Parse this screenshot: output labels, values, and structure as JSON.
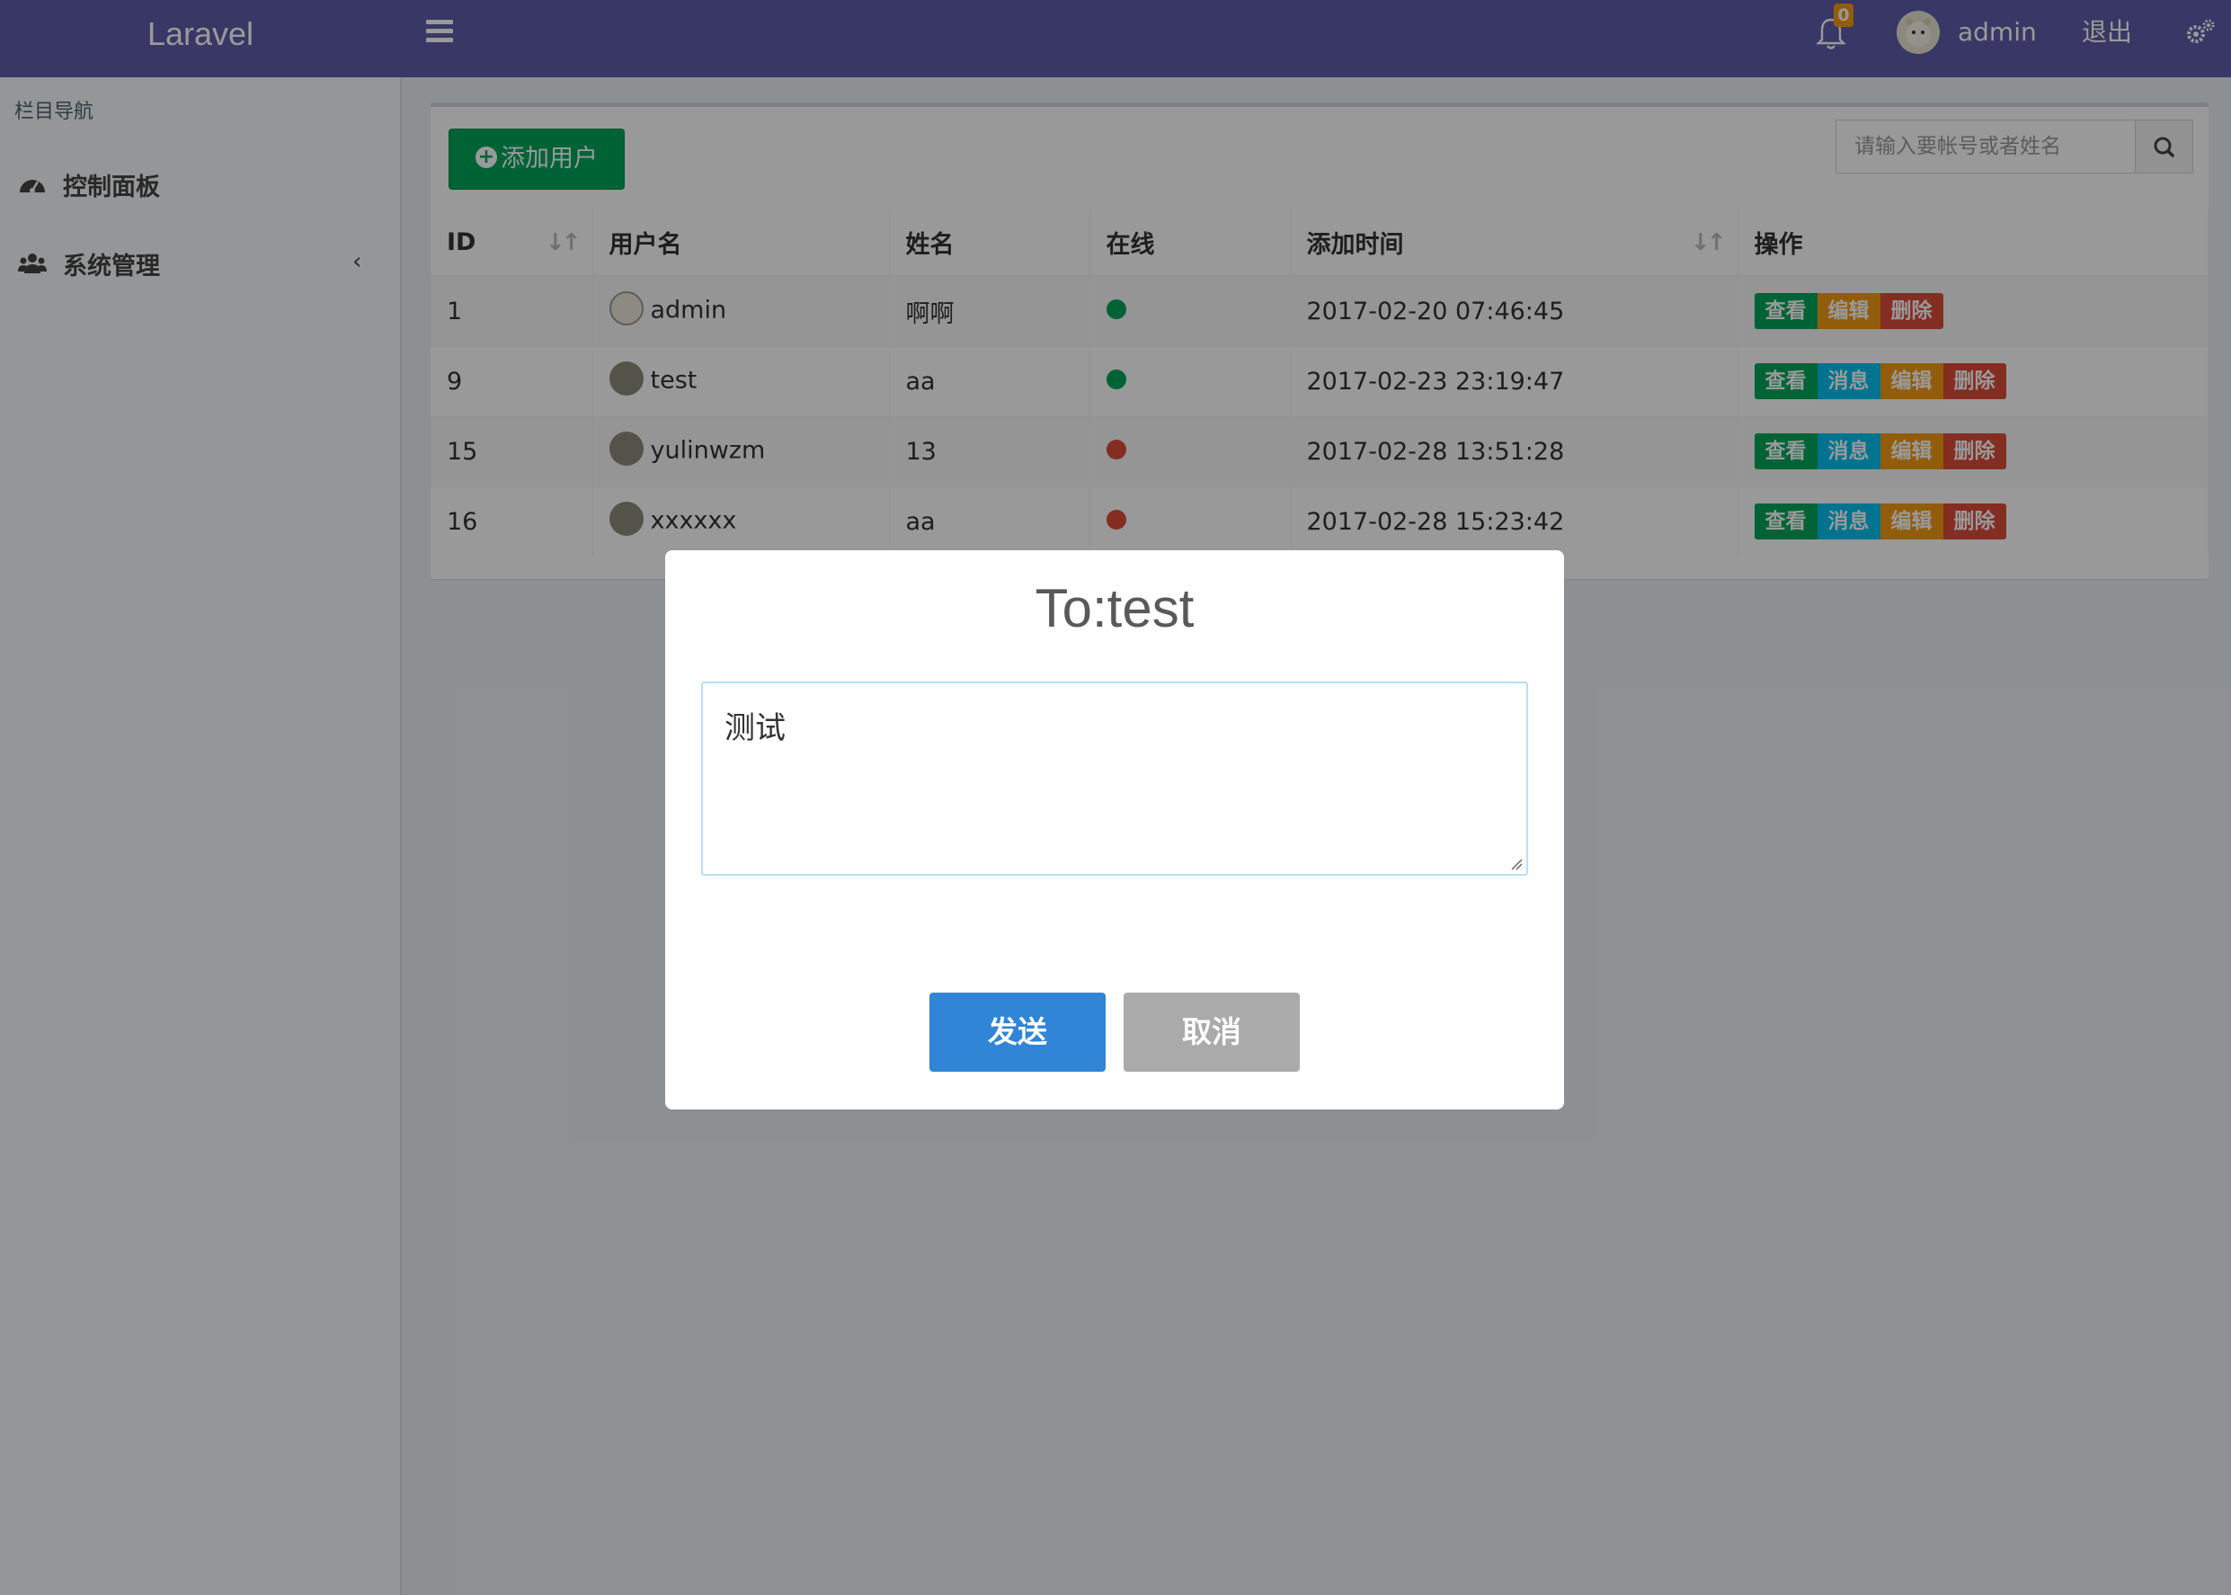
{
  "header": {
    "logo": "Laravel",
    "notification_count": "0",
    "username": "admin",
    "logout_label": "退出",
    "icons": [
      "hamburger-menu-icon",
      "bell-icon",
      "gears-icon"
    ]
  },
  "sidebar": {
    "header": "栏目导航",
    "items": [
      {
        "label": "控制面板",
        "icon": "dashboard-icon"
      },
      {
        "label": "系统管理",
        "icon": "users-icon",
        "chevron": "‹"
      }
    ]
  },
  "toolbar": {
    "add_user_label": "添加用户",
    "search_placeholder": "请输入要帐号或者姓名"
  },
  "table": {
    "headers": [
      "ID",
      "用户名",
      "姓名",
      "在线",
      "添加时间",
      "操作"
    ],
    "rows": [
      {
        "id": "1",
        "username": "admin",
        "name": "啊啊",
        "online": true,
        "added": "2017-02-20 07:46:45",
        "actions": [
          "查看",
          "编辑",
          "删除"
        ]
      },
      {
        "id": "9",
        "username": "test",
        "name": "aa",
        "online": true,
        "added": "2017-02-23 23:19:47",
        "actions": [
          "查看",
          "消息",
          "编辑",
          "删除"
        ]
      },
      {
        "id": "15",
        "username": "yulinwzm",
        "name": "13",
        "online": false,
        "added": "2017-02-28 13:51:28",
        "actions": [
          "查看",
          "消息",
          "编辑",
          "删除"
        ]
      },
      {
        "id": "16",
        "username": "xxxxxx",
        "name": "aa",
        "online": false,
        "added": "2017-02-28 15:23:42",
        "actions": [
          "查看",
          "消息",
          "编辑",
          "删除"
        ]
      }
    ]
  },
  "modal": {
    "title": "To:test",
    "message": "测试",
    "send_label": "发送",
    "cancel_label": "取消"
  },
  "colors": {
    "header_bg": "#605ca8",
    "online": "#00a65a",
    "offline": "#dd4b39",
    "send": "#3085d6",
    "cancel": "#aaaaaa"
  }
}
